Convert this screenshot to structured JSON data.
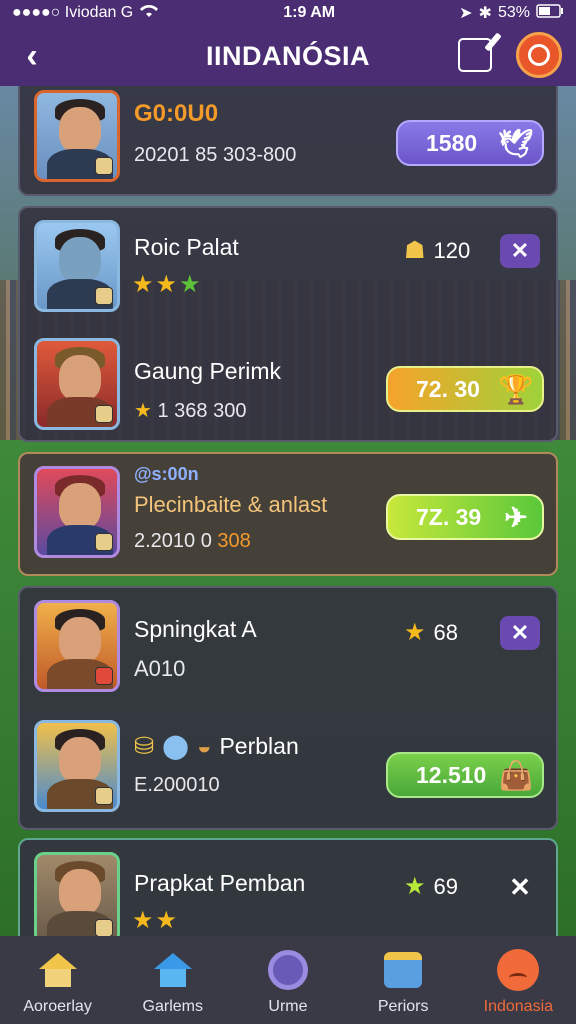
{
  "status_bar": {
    "carrier": "●●●●○ Iviodan  G",
    "wifi_icon": "wifi-icon",
    "time": "1:9 AM",
    "battery": "53%"
  },
  "header": {
    "title": "IINDANÓSIA",
    "back_icon": "chevron-left-icon",
    "edit_icon": "edit-icon",
    "target_icon": "target-icon"
  },
  "cards": [
    {
      "name": "G0:0U0",
      "subtitle": "20201 85 303-800",
      "pill_value": "1580"
    },
    {
      "players": [
        {
          "name": "Roic Palat",
          "stat_value": "120"
        },
        {
          "name": "Gaung Perimk",
          "subtitle": "1 368 300",
          "pill_value": "72. 30"
        }
      ]
    },
    {
      "tag": "@s:00n",
      "name": "Plecinbaite & anlast",
      "subtitle": "2.2010 0",
      "subtitle_highlight": "308",
      "pill_value": "7Z. 39"
    },
    {
      "players": [
        {
          "name": "Spningkat A",
          "subtitle": "A0",
          "subtitle_rest": "10",
          "stat_value": "68"
        },
        {
          "name": "Perblan",
          "subtitle": "E.200010",
          "pill_value": "12.510"
        }
      ]
    },
    {
      "name": "Prapkat Pemban",
      "stat_value": "69"
    }
  ],
  "tab_bar": {
    "tabs": [
      {
        "label": "Aoroerlay",
        "icon": "home-icon"
      },
      {
        "label": "Garlems",
        "icon": "home-icon"
      },
      {
        "label": "Urme",
        "icon": "ring-icon"
      },
      {
        "label": "Periors",
        "icon": "box-icon"
      },
      {
        "label": "Indonasia",
        "icon": "smiley-icon"
      }
    ]
  },
  "colors": {
    "header_bg": "#4a2d72",
    "accent_orange": "#f39a2a",
    "active_tab": "#f06a3a",
    "card_bg": "#343440"
  }
}
